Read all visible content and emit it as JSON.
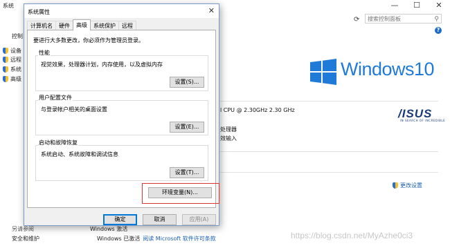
{
  "background": {
    "window_title": "系统",
    "caption_buttons": [
      "—",
      "☐",
      "✕"
    ],
    "search_placeholder": "搜索控制面板",
    "help_label": "?",
    "sidebar": {
      "title": "控制",
      "items": [
        "设备",
        "远程",
        "系统",
        "高级"
      ],
      "see_also": "另请参阅",
      "security": "安全和维护"
    },
    "logo_text": "Windows10",
    "cpu_text": "l CPU @ 2.30GHz   2.30 GHz",
    "processor_text": "处理器",
    "input_text": "效输入",
    "brand": {
      "name": "/ISUS",
      "tagline": "IN SEARCH OF INCREDIBLE"
    },
    "change_settings": "更改设置",
    "product_label": "Windows 激活",
    "activation_text": "Windows 已激活",
    "activation_link": "阅读 Microsoft 软件许可条款",
    "watermark": "https://blog.csdn.net/MyAzhe0ci3"
  },
  "dialog": {
    "title": "系统属性",
    "close_label": "✕",
    "tabs": [
      {
        "label": "计算机名",
        "active": false
      },
      {
        "label": "硬件",
        "active": false
      },
      {
        "label": "高级",
        "active": true
      },
      {
        "label": "系统保护",
        "active": false
      },
      {
        "label": "远程",
        "active": false
      }
    ],
    "admin_note": "要进行大多数更改，你必须作为管理员登录。",
    "groups": {
      "performance": {
        "title": "性能",
        "desc": "视觉效果，处理器计划，内存使用，以及虚拟内存",
        "button": "设置(S)..."
      },
      "profiles": {
        "title": "用户配置文件",
        "desc": "与登录帐户相关的桌面设置",
        "button": "设置(E)..."
      },
      "startup": {
        "title": "启动和故障恢复",
        "desc": "系统启动、系统故障和调试信息",
        "button": "设置(T)..."
      }
    },
    "env_button": "环境变量(N)...",
    "footer": {
      "ok": "确定",
      "cancel": "取消",
      "apply": "应用(A)"
    }
  },
  "colors": {
    "accent": "#0078d7",
    "highlight_box": "#e0332e",
    "windows_blue": "#1f7ad8"
  }
}
